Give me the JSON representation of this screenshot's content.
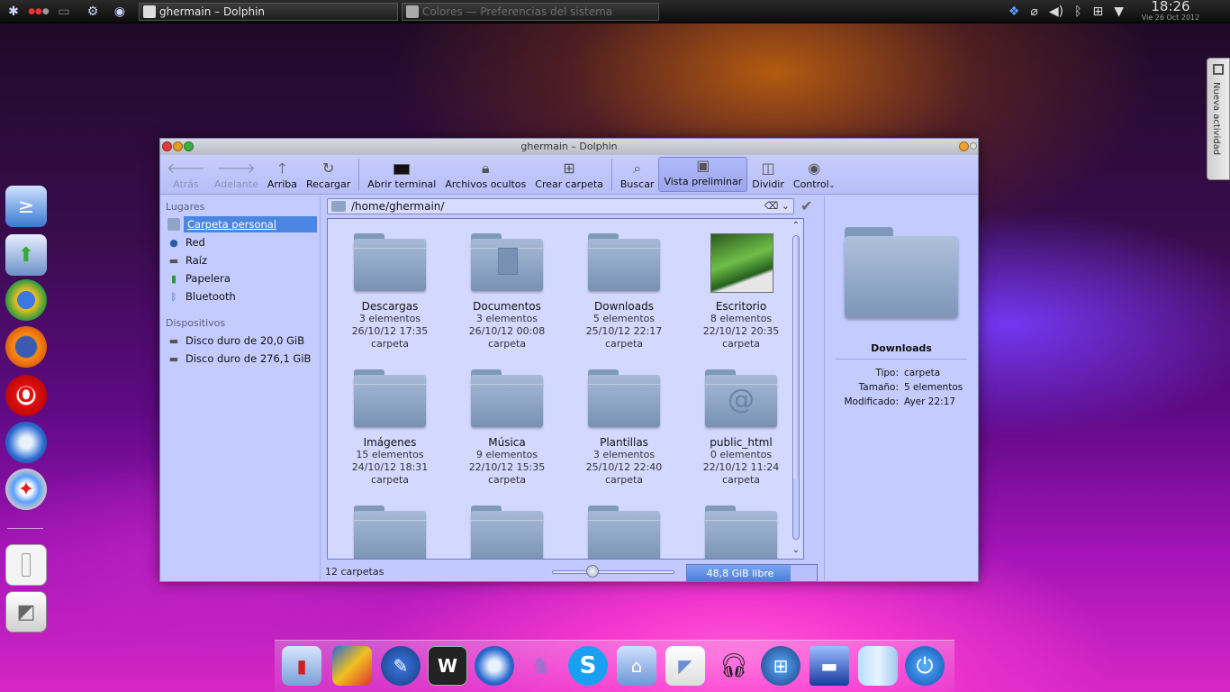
{
  "top_panel": {
    "tasks": [
      {
        "label": "ghermain – Dolphin",
        "active": true
      },
      {
        "label": "Colores — Preferencias del sistema",
        "active": false
      }
    ],
    "clock": {
      "time": "18:26",
      "date": "Vie 26 Oct 2012"
    },
    "tray_icons": [
      "dropbox-icon",
      "paperclip-icon",
      "volume-icon",
      "bluetooth-icon",
      "network-icon",
      "chevron-down-icon"
    ]
  },
  "activity_tab": {
    "label": "Nueva actividad"
  },
  "window": {
    "title": "ghermain – Dolphin",
    "toolbar": {
      "back": "Atrás",
      "forward": "Adelante",
      "up": "Arriba",
      "reload": "Recargar",
      "terminal": "Abrir terminal",
      "hidden": "Archivos ocultos",
      "new_folder": "Crear carpeta",
      "search": "Buscar",
      "preview": "Vista preliminar",
      "split": "Dividir",
      "control": "Control"
    },
    "places": {
      "header": "Lugares",
      "items": [
        {
          "label": "Carpeta personal",
          "icon": "home-folder-icon"
        },
        {
          "label": "Red",
          "icon": "network-globe-icon"
        },
        {
          "label": "Raíz",
          "icon": "drive-icon"
        },
        {
          "label": "Papelera",
          "icon": "trash-icon"
        },
        {
          "label": "Bluetooth",
          "icon": "bluetooth-icon"
        }
      ],
      "devices_header": "Dispositivos",
      "devices": [
        {
          "label": "Disco duro de 20,0 GiB"
        },
        {
          "label": "Disco duro de 276,1 GiB"
        }
      ]
    },
    "path": "/home/ghermain/",
    "files": [
      {
        "name": "Descargas",
        "count": "3 elementos",
        "date": "26/10/12 17:35",
        "type": "carpeta",
        "glyph": ""
      },
      {
        "name": "Documentos",
        "count": "3 elementos",
        "date": "26/10/12 00:08",
        "type": "carpeta",
        "glyph": "doc"
      },
      {
        "name": "Downloads",
        "count": "5 elementos",
        "date": "25/10/12 22:17",
        "type": "carpeta",
        "glyph": ""
      },
      {
        "name": "Escritorio",
        "count": "8 elementos",
        "date": "22/10/12 20:35",
        "type": "carpeta",
        "glyph": "pic"
      },
      {
        "name": "Imágenes",
        "count": "15 elementos",
        "date": "24/10/12 18:31",
        "type": "carpeta",
        "glyph": ""
      },
      {
        "name": "Música",
        "count": "9 elementos",
        "date": "22/10/12 15:35",
        "type": "carpeta",
        "glyph": ""
      },
      {
        "name": "Plantillas",
        "count": "3 elementos",
        "date": "25/10/12 22:40",
        "type": "carpeta",
        "glyph": ""
      },
      {
        "name": "public_html",
        "count": "0 elementos",
        "date": "22/10/12 11:24",
        "type": "carpeta",
        "glyph": "@"
      }
    ],
    "status": {
      "count": "12 carpetas",
      "free": "48,8 GiB libre",
      "used_fraction": 0.8
    },
    "info": {
      "name": "Downloads",
      "rows": [
        {
          "k": "Tipo:",
          "v": "carpeta"
        },
        {
          "k": "Tamaño:",
          "v": "5 elementos"
        },
        {
          "k": "Modificado:",
          "v": "Ayer 22:17"
        }
      ]
    }
  },
  "colors": {
    "accent": "#4a86e2",
    "window_bg": "#c2c9ff",
    "files_bg": "#d3d8ff"
  }
}
